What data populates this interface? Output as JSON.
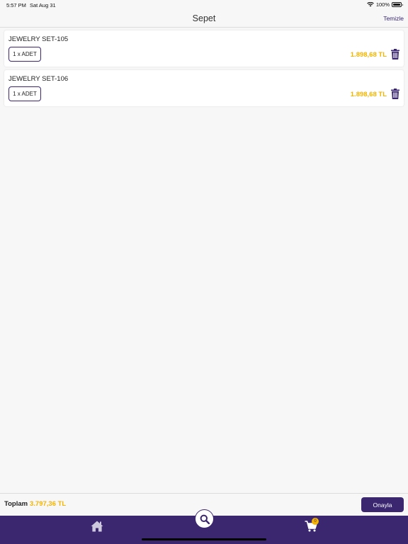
{
  "status_bar": {
    "time": "5:57 PM",
    "date": "Sat Aug 31",
    "battery": "100%"
  },
  "nav": {
    "title": "Sepet",
    "clear_label": "Temizle"
  },
  "cart": {
    "items": [
      {
        "name": "JEWELRY SET-105",
        "quantity_label": "1 x ADET",
        "price": "1.898,68 TL"
      },
      {
        "name": "JEWELRY SET-106",
        "quantity_label": "1 x ADET",
        "price": "1.898,68 TL"
      }
    ]
  },
  "footer": {
    "total_label": "Toplam",
    "total_value": "3.797,36 TL",
    "confirm_label": "Onayla"
  },
  "tabbar": {
    "cart_badge": "0",
    "icons": [
      "home-icon",
      "search-icon",
      "cart-icon"
    ]
  },
  "colors": {
    "brand": "#3b2770",
    "accent": "#f5b400",
    "background": "#f7f7f7"
  }
}
